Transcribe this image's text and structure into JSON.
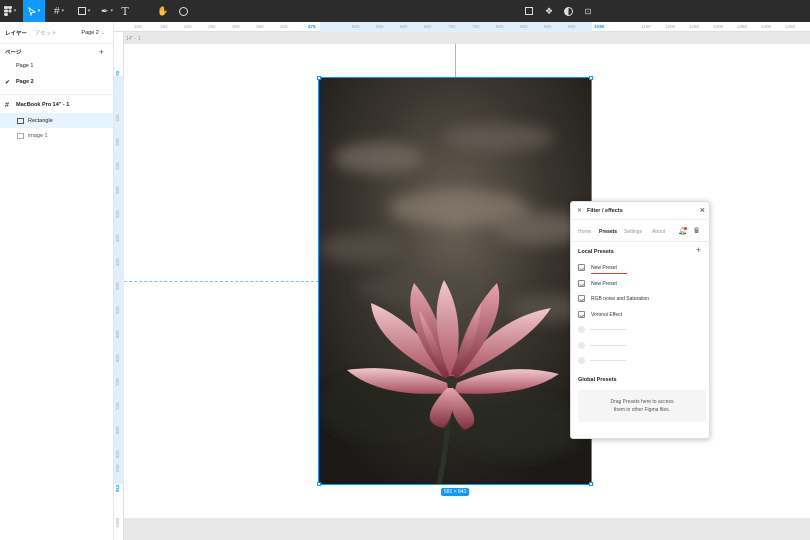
{
  "toolbar": {
    "icons": [
      "figma-menu-icon",
      "move-tool-icon",
      "frame-tool-icon",
      "shape-tool-icon",
      "pen-tool-icon",
      "text-tool-icon",
      "hand-tool-icon",
      "comment-tool-icon",
      "crop-icon",
      "component-icon",
      "mask-icon",
      "adjust-icon"
    ]
  },
  "ruler": {
    "h_ticks": [
      "100",
      "150",
      "200",
      "250",
      "300",
      "350",
      "400",
      "475",
      "500",
      "550",
      "600",
      "650",
      "700",
      "750",
      "800",
      "850",
      "900",
      "950",
      "1036",
      "1150",
      "1200",
      "1250",
      "1300",
      "1350",
      "1400",
      "1450"
    ],
    "v_ticks": [
      "70",
      "150",
      "200",
      "250",
      "300",
      "350",
      "400",
      "450",
      "500",
      "550",
      "600",
      "650",
      "700",
      "750",
      "800",
      "850",
      "900",
      "912",
      "1000"
    ]
  },
  "left_panel": {
    "tab_layers": "レイヤー",
    "tab_assets": "アセット",
    "page_selector": "Page 2",
    "pages_header": "ページ",
    "pages": [
      {
        "label": "Page 1",
        "checked": false
      },
      {
        "label": "Page 2",
        "checked": true
      }
    ],
    "layers": [
      {
        "label": "MacBook Pro 14\" - 1",
        "type": "frame"
      },
      {
        "label": "Rectangle",
        "type": "rectangle",
        "selected": true
      },
      {
        "label": "image 1",
        "type": "image"
      }
    ]
  },
  "canvas": {
    "frame_label": "14\" - 1",
    "size_badge": "581 × 843"
  },
  "plugin": {
    "title": "Filter / effects",
    "tabs": [
      "Home",
      "Presets",
      "Settings",
      "About"
    ],
    "active_tab": "Presets",
    "local_header": "Local Presets",
    "presets": [
      "New Preset",
      "New Preset",
      "RGB noise and Saturation",
      "Voronoi Effect"
    ],
    "global_header": "Global Presets",
    "drop_text_1": "Drag Presets here to access",
    "drop_text_2": "them in other Figma files."
  },
  "colors": {
    "accent": "#0d99ff",
    "toolbar_bg": "#2c2c2c",
    "underline": "#e53935"
  }
}
